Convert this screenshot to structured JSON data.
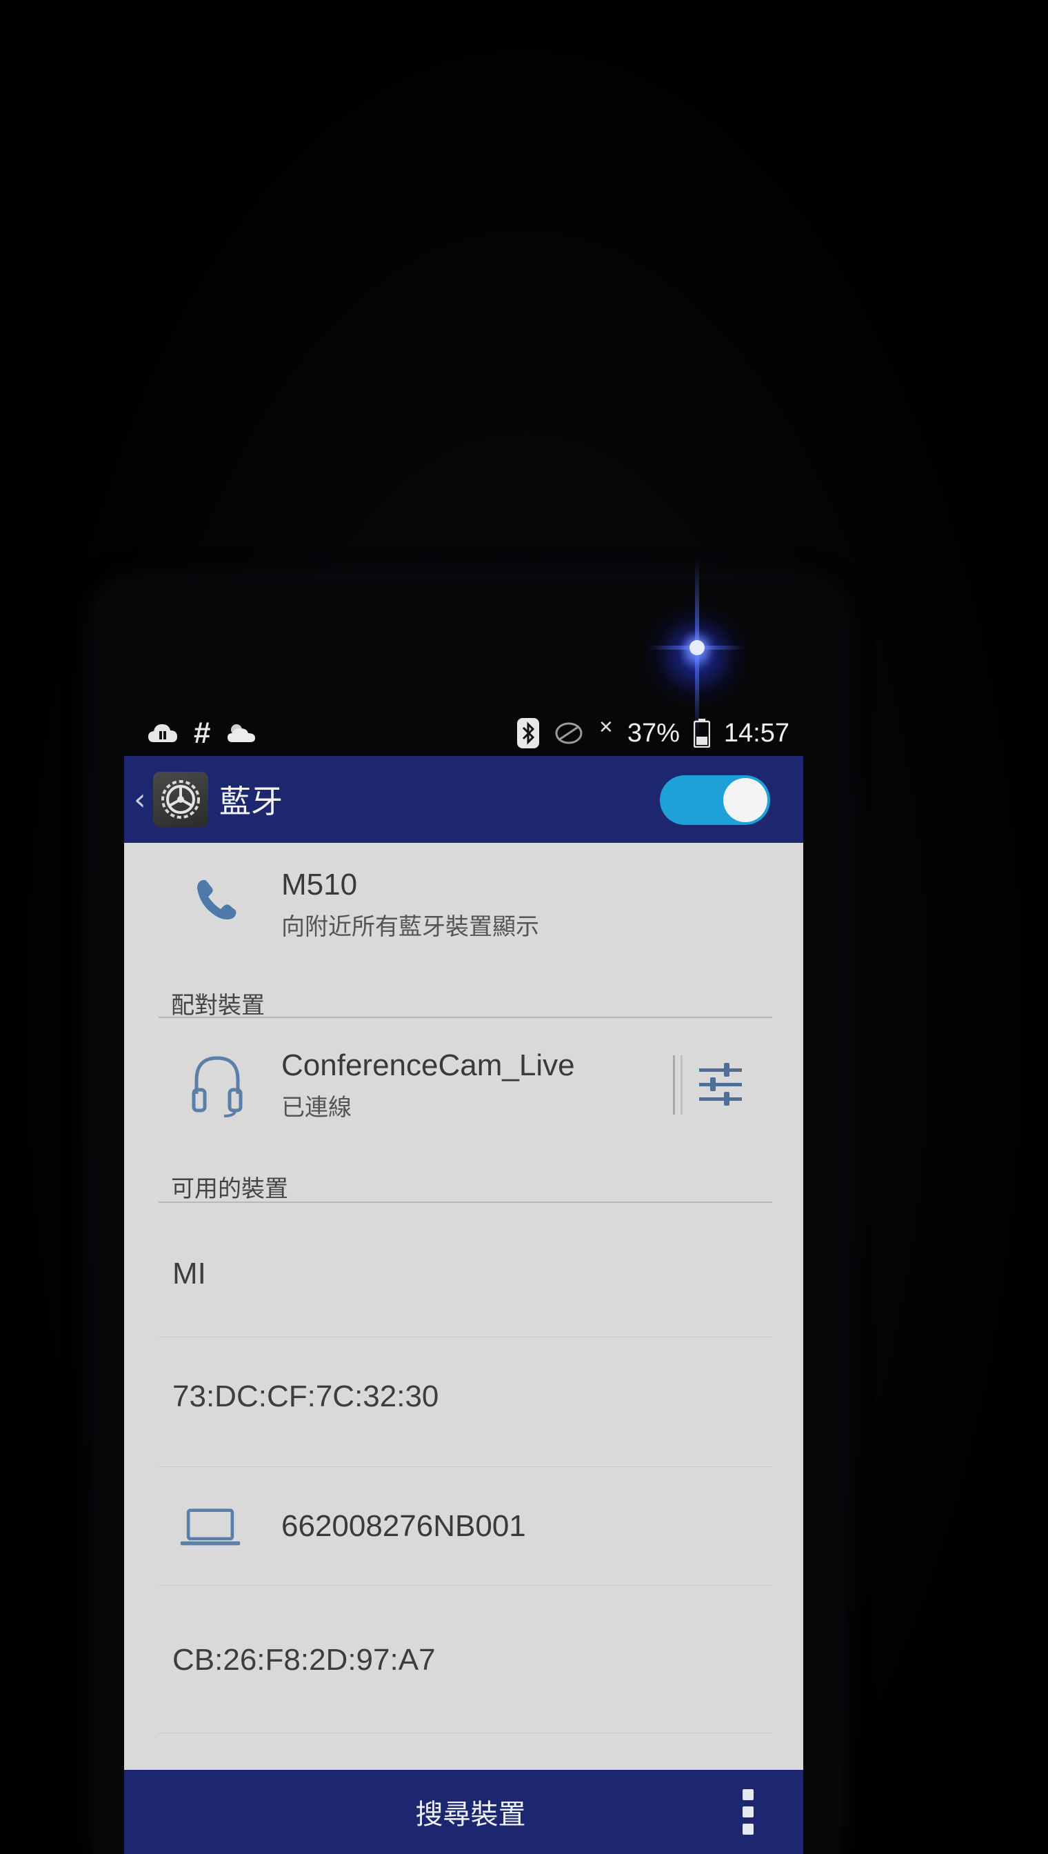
{
  "status_bar": {
    "battery": "37%",
    "time": "14:57",
    "icons": [
      "cloud-upload-icon",
      "hash-icon",
      "weather-cloud-icon",
      "bluetooth-icon",
      "sync-icon",
      "no-signal-icon",
      "battery-icon"
    ]
  },
  "action_bar": {
    "title": "藍牙",
    "toggle_on": true,
    "accent": "#1ea0d8",
    "bar_color": "#1c2770"
  },
  "device": {
    "name": "M510",
    "visibility": "向附近所有藍牙裝置顯示",
    "icon": "phone-icon"
  },
  "paired": {
    "header": "配對裝置",
    "items": [
      {
        "name": "ConferenceCam_Live",
        "status": "已連線",
        "icon": "headset-icon"
      }
    ]
  },
  "available": {
    "header": "可用的裝置",
    "items": [
      {
        "name": "MI"
      },
      {
        "name": "73:DC:CF:7C:32:30"
      },
      {
        "name": "662008276NB001",
        "icon": "laptop-icon"
      },
      {
        "name": "CB:26:F8:2D:97:A7"
      }
    ]
  },
  "bottom_bar": {
    "search_label": "搜尋裝置"
  }
}
